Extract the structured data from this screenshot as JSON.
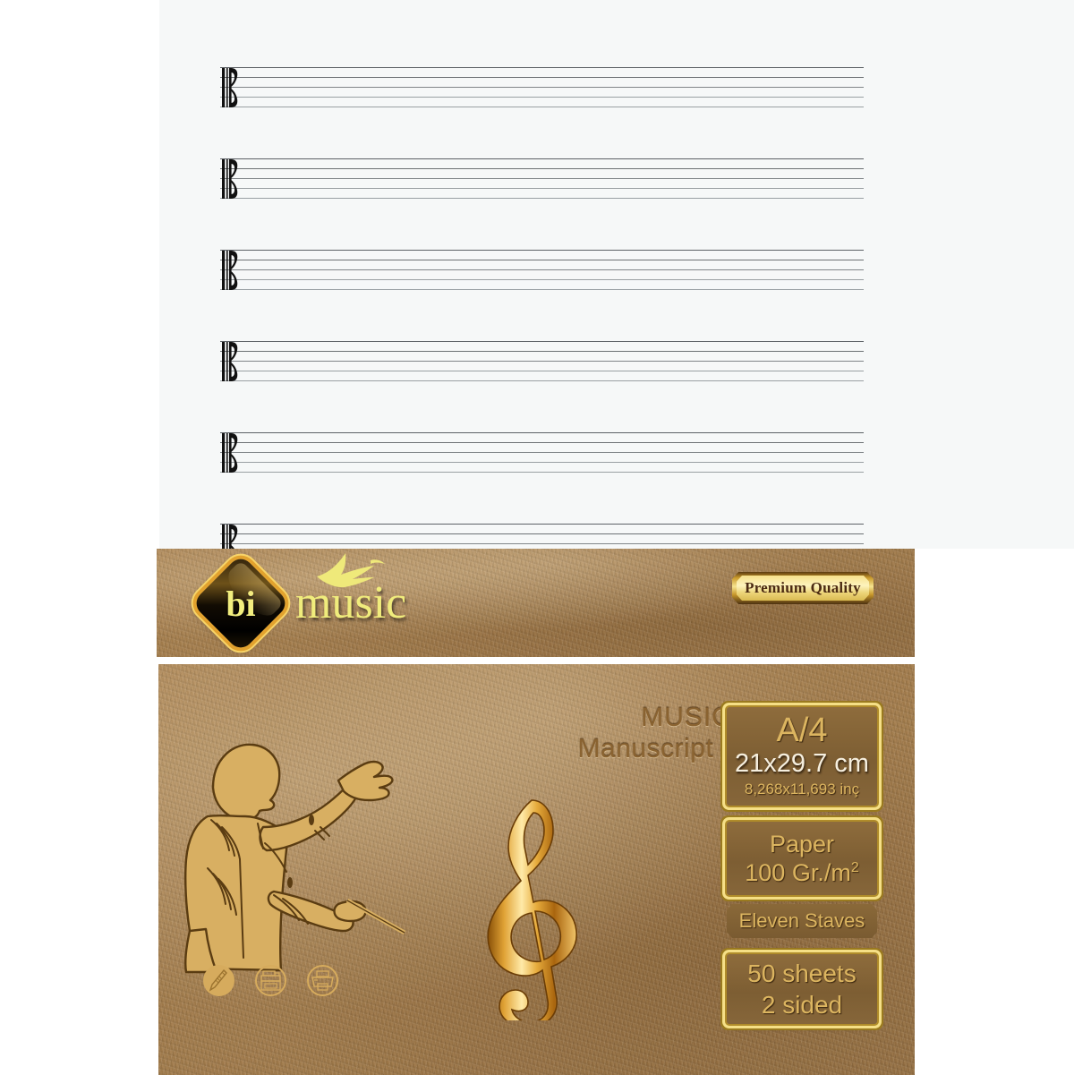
{
  "product": {
    "sheet": {
      "stave_count_visible": 6,
      "clef_name": "alto-c-clef",
      "lines_per_stave": 5
    },
    "brand_band": {
      "logo_mark_text": "bi",
      "logo_word": "music",
      "bird_icon": "swallow-bird-icon",
      "badge_label": "Premium Quality"
    },
    "cover": {
      "title_line1": "MUSIC",
      "title_line2": "Manuscript Paper",
      "conductor_icon": "conductor-silhouette-icon",
      "clef_icon": "treble-clef-icon",
      "info_boxes": [
        {
          "id": "size",
          "line1": "A/4",
          "line2": "21x29.7 cm",
          "line3": "8,268x11,693 inç"
        },
        {
          "id": "paper",
          "line1": "Paper",
          "line2": "100 Gr./m",
          "line2_sup": "2"
        },
        {
          "id": "staves",
          "line1": "Eleven Staves"
        },
        {
          "id": "sheets",
          "line1": "50 sheets",
          "line2": "2 sided"
        }
      ],
      "usage_icons": [
        {
          "id": "pencil-icon",
          "label": "pencil-writing-icon"
        },
        {
          "id": "copier-icon",
          "label": "photocopier-icon"
        },
        {
          "id": "printer-icon",
          "label": "printer-icon"
        }
      ]
    }
  },
  "colors": {
    "kraft": "#a9814f",
    "gold": "#dcb560",
    "gold_bright": "#f5df86",
    "logo_yellow": "#f0ec7c",
    "sheet_white": "#f6f8f8",
    "stave_line": "#7f8487",
    "title_brown": "#8a6331"
  }
}
